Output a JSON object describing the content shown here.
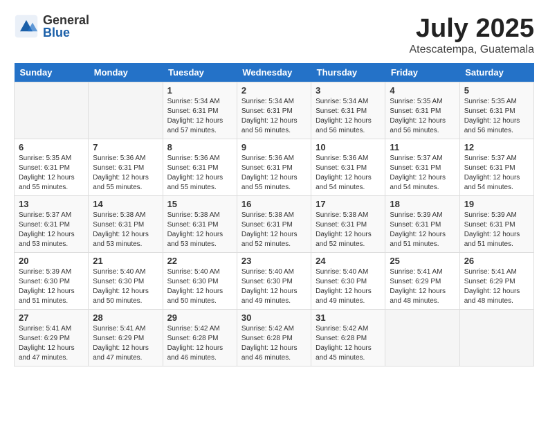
{
  "header": {
    "logo_general": "General",
    "logo_blue": "Blue",
    "month_title": "July 2025",
    "location": "Atescatempa, Guatemala"
  },
  "days_of_week": [
    "Sunday",
    "Monday",
    "Tuesday",
    "Wednesday",
    "Thursday",
    "Friday",
    "Saturday"
  ],
  "weeks": [
    [
      {
        "day": "",
        "info": ""
      },
      {
        "day": "",
        "info": ""
      },
      {
        "day": "1",
        "info": "Sunrise: 5:34 AM\nSunset: 6:31 PM\nDaylight: 12 hours and 57 minutes."
      },
      {
        "day": "2",
        "info": "Sunrise: 5:34 AM\nSunset: 6:31 PM\nDaylight: 12 hours and 56 minutes."
      },
      {
        "day": "3",
        "info": "Sunrise: 5:34 AM\nSunset: 6:31 PM\nDaylight: 12 hours and 56 minutes."
      },
      {
        "day": "4",
        "info": "Sunrise: 5:35 AM\nSunset: 6:31 PM\nDaylight: 12 hours and 56 minutes."
      },
      {
        "day": "5",
        "info": "Sunrise: 5:35 AM\nSunset: 6:31 PM\nDaylight: 12 hours and 56 minutes."
      }
    ],
    [
      {
        "day": "6",
        "info": "Sunrise: 5:35 AM\nSunset: 6:31 PM\nDaylight: 12 hours and 55 minutes."
      },
      {
        "day": "7",
        "info": "Sunrise: 5:36 AM\nSunset: 6:31 PM\nDaylight: 12 hours and 55 minutes."
      },
      {
        "day": "8",
        "info": "Sunrise: 5:36 AM\nSunset: 6:31 PM\nDaylight: 12 hours and 55 minutes."
      },
      {
        "day": "9",
        "info": "Sunrise: 5:36 AM\nSunset: 6:31 PM\nDaylight: 12 hours and 55 minutes."
      },
      {
        "day": "10",
        "info": "Sunrise: 5:36 AM\nSunset: 6:31 PM\nDaylight: 12 hours and 54 minutes."
      },
      {
        "day": "11",
        "info": "Sunrise: 5:37 AM\nSunset: 6:31 PM\nDaylight: 12 hours and 54 minutes."
      },
      {
        "day": "12",
        "info": "Sunrise: 5:37 AM\nSunset: 6:31 PM\nDaylight: 12 hours and 54 minutes."
      }
    ],
    [
      {
        "day": "13",
        "info": "Sunrise: 5:37 AM\nSunset: 6:31 PM\nDaylight: 12 hours and 53 minutes."
      },
      {
        "day": "14",
        "info": "Sunrise: 5:38 AM\nSunset: 6:31 PM\nDaylight: 12 hours and 53 minutes."
      },
      {
        "day": "15",
        "info": "Sunrise: 5:38 AM\nSunset: 6:31 PM\nDaylight: 12 hours and 53 minutes."
      },
      {
        "day": "16",
        "info": "Sunrise: 5:38 AM\nSunset: 6:31 PM\nDaylight: 12 hours and 52 minutes."
      },
      {
        "day": "17",
        "info": "Sunrise: 5:38 AM\nSunset: 6:31 PM\nDaylight: 12 hours and 52 minutes."
      },
      {
        "day": "18",
        "info": "Sunrise: 5:39 AM\nSunset: 6:31 PM\nDaylight: 12 hours and 51 minutes."
      },
      {
        "day": "19",
        "info": "Sunrise: 5:39 AM\nSunset: 6:31 PM\nDaylight: 12 hours and 51 minutes."
      }
    ],
    [
      {
        "day": "20",
        "info": "Sunrise: 5:39 AM\nSunset: 6:30 PM\nDaylight: 12 hours and 51 minutes."
      },
      {
        "day": "21",
        "info": "Sunrise: 5:40 AM\nSunset: 6:30 PM\nDaylight: 12 hours and 50 minutes."
      },
      {
        "day": "22",
        "info": "Sunrise: 5:40 AM\nSunset: 6:30 PM\nDaylight: 12 hours and 50 minutes."
      },
      {
        "day": "23",
        "info": "Sunrise: 5:40 AM\nSunset: 6:30 PM\nDaylight: 12 hours and 49 minutes."
      },
      {
        "day": "24",
        "info": "Sunrise: 5:40 AM\nSunset: 6:30 PM\nDaylight: 12 hours and 49 minutes."
      },
      {
        "day": "25",
        "info": "Sunrise: 5:41 AM\nSunset: 6:29 PM\nDaylight: 12 hours and 48 minutes."
      },
      {
        "day": "26",
        "info": "Sunrise: 5:41 AM\nSunset: 6:29 PM\nDaylight: 12 hours and 48 minutes."
      }
    ],
    [
      {
        "day": "27",
        "info": "Sunrise: 5:41 AM\nSunset: 6:29 PM\nDaylight: 12 hours and 47 minutes."
      },
      {
        "day": "28",
        "info": "Sunrise: 5:41 AM\nSunset: 6:29 PM\nDaylight: 12 hours and 47 minutes."
      },
      {
        "day": "29",
        "info": "Sunrise: 5:42 AM\nSunset: 6:28 PM\nDaylight: 12 hours and 46 minutes."
      },
      {
        "day": "30",
        "info": "Sunrise: 5:42 AM\nSunset: 6:28 PM\nDaylight: 12 hours and 46 minutes."
      },
      {
        "day": "31",
        "info": "Sunrise: 5:42 AM\nSunset: 6:28 PM\nDaylight: 12 hours and 45 minutes."
      },
      {
        "day": "",
        "info": ""
      },
      {
        "day": "",
        "info": ""
      }
    ]
  ]
}
